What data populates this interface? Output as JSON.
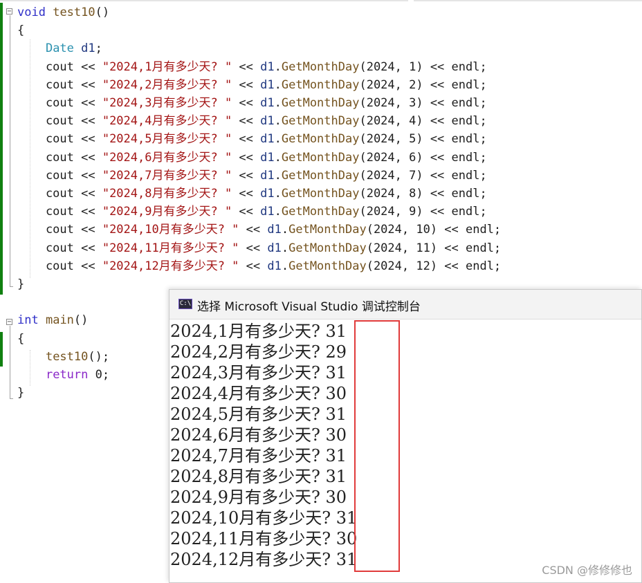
{
  "editor": {
    "lines": [
      {
        "fold": "minus",
        "parts": [
          [
            "kw",
            "void"
          ],
          [
            "op",
            " "
          ],
          [
            "fn",
            "test10"
          ],
          [
            "op",
            "()"
          ]
        ]
      },
      {
        "parts": [
          [
            "op",
            "{"
          ]
        ]
      },
      {
        "parts": [
          [
            "op",
            "    "
          ],
          [
            "ty",
            "Date"
          ],
          [
            "op",
            " "
          ],
          [
            "id",
            "d1"
          ],
          [
            "op",
            ";"
          ]
        ]
      },
      {
        "parts": [
          [
            "op",
            "    cout << "
          ],
          [
            "str",
            "\"2024,1月有多少天? \""
          ],
          [
            "op",
            " << "
          ],
          [
            "id",
            "d1"
          ],
          [
            "op",
            "."
          ],
          [
            "fn",
            "GetMonthDay"
          ],
          [
            "op",
            "(2024, 1) << endl;"
          ]
        ]
      },
      {
        "parts": [
          [
            "op",
            "    cout << "
          ],
          [
            "str",
            "\"2024,2月有多少天? \""
          ],
          [
            "op",
            " << "
          ],
          [
            "id",
            "d1"
          ],
          [
            "op",
            "."
          ],
          [
            "fn",
            "GetMonthDay"
          ],
          [
            "op",
            "(2024, 2) << endl;"
          ]
        ]
      },
      {
        "parts": [
          [
            "op",
            "    cout << "
          ],
          [
            "str",
            "\"2024,3月有多少天? \""
          ],
          [
            "op",
            " << "
          ],
          [
            "id",
            "d1"
          ],
          [
            "op",
            "."
          ],
          [
            "fn",
            "GetMonthDay"
          ],
          [
            "op",
            "(2024, 3) << endl;"
          ]
        ]
      },
      {
        "parts": [
          [
            "op",
            "    cout << "
          ],
          [
            "str",
            "\"2024,4月有多少天? \""
          ],
          [
            "op",
            " << "
          ],
          [
            "id",
            "d1"
          ],
          [
            "op",
            "."
          ],
          [
            "fn",
            "GetMonthDay"
          ],
          [
            "op",
            "(2024, 4) << endl;"
          ]
        ]
      },
      {
        "parts": [
          [
            "op",
            "    cout << "
          ],
          [
            "str",
            "\"2024,5月有多少天? \""
          ],
          [
            "op",
            " << "
          ],
          [
            "id",
            "d1"
          ],
          [
            "op",
            "."
          ],
          [
            "fn",
            "GetMonthDay"
          ],
          [
            "op",
            "(2024, 5) << endl;"
          ]
        ]
      },
      {
        "parts": [
          [
            "op",
            "    cout << "
          ],
          [
            "str",
            "\"2024,6月有多少天? \""
          ],
          [
            "op",
            " << "
          ],
          [
            "id",
            "d1"
          ],
          [
            "op",
            "."
          ],
          [
            "fn",
            "GetMonthDay"
          ],
          [
            "op",
            "(2024, 6) << endl;"
          ]
        ]
      },
      {
        "parts": [
          [
            "op",
            "    cout << "
          ],
          [
            "str",
            "\"2024,7月有多少天? \""
          ],
          [
            "op",
            " << "
          ],
          [
            "id",
            "d1"
          ],
          [
            "op",
            "."
          ],
          [
            "fn",
            "GetMonthDay"
          ],
          [
            "op",
            "(2024, 7) << endl;"
          ]
        ]
      },
      {
        "parts": [
          [
            "op",
            "    cout << "
          ],
          [
            "str",
            "\"2024,8月有多少天? \""
          ],
          [
            "op",
            " << "
          ],
          [
            "id",
            "d1"
          ],
          [
            "op",
            "."
          ],
          [
            "fn",
            "GetMonthDay"
          ],
          [
            "op",
            "(2024, 8) << endl;"
          ]
        ]
      },
      {
        "parts": [
          [
            "op",
            "    cout << "
          ],
          [
            "str",
            "\"2024,9月有多少天? \""
          ],
          [
            "op",
            " << "
          ],
          [
            "id",
            "d1"
          ],
          [
            "op",
            "."
          ],
          [
            "fn",
            "GetMonthDay"
          ],
          [
            "op",
            "(2024, 9) << endl;"
          ]
        ]
      },
      {
        "parts": [
          [
            "op",
            "    cout << "
          ],
          [
            "str",
            "\"2024,10月有多少天? \""
          ],
          [
            "op",
            " << "
          ],
          [
            "id",
            "d1"
          ],
          [
            "op",
            "."
          ],
          [
            "fn",
            "GetMonthDay"
          ],
          [
            "op",
            "(2024, 10) << endl;"
          ]
        ]
      },
      {
        "parts": [
          [
            "op",
            "    cout << "
          ],
          [
            "str",
            "\"2024,11月有多少天? \""
          ],
          [
            "op",
            " << "
          ],
          [
            "id",
            "d1"
          ],
          [
            "op",
            "."
          ],
          [
            "fn",
            "GetMonthDay"
          ],
          [
            "op",
            "(2024, 11) << endl;"
          ]
        ]
      },
      {
        "parts": [
          [
            "op",
            "    cout << "
          ],
          [
            "str",
            "\"2024,12月有多少天? \""
          ],
          [
            "op",
            " << "
          ],
          [
            "id",
            "d1"
          ],
          [
            "op",
            "."
          ],
          [
            "fn",
            "GetMonthDay"
          ],
          [
            "op",
            "(2024, 12) << endl;"
          ]
        ]
      },
      {
        "parts": [
          [
            "op",
            "}"
          ]
        ]
      },
      {
        "parts": []
      },
      {
        "fold": "minus",
        "parts": [
          [
            "kw",
            "int"
          ],
          [
            "op",
            " "
          ],
          [
            "fn",
            "main"
          ],
          [
            "op",
            "()"
          ]
        ]
      },
      {
        "parts": [
          [
            "op",
            "{"
          ]
        ]
      },
      {
        "parts": [
          [
            "op",
            "    "
          ],
          [
            "fn",
            "test10"
          ],
          [
            "op",
            "();"
          ]
        ]
      },
      {
        "parts": [
          [
            "op",
            "    "
          ],
          [
            "kw2",
            "return"
          ],
          [
            "op",
            " 0;"
          ]
        ]
      },
      {
        "parts": [
          [
            "op",
            "}"
          ]
        ]
      }
    ]
  },
  "console": {
    "icon_text": "C:\\",
    "title": "选择 Microsoft Visual Studio 调试控制台",
    "output": [
      {
        "prompt": "2024,1月有多少天? ",
        "value": "31"
      },
      {
        "prompt": "2024,2月有多少天? ",
        "value": "29"
      },
      {
        "prompt": "2024,3月有多少天? ",
        "value": "31"
      },
      {
        "prompt": "2024,4月有多少天? ",
        "value": "30"
      },
      {
        "prompt": "2024,5月有多少天? ",
        "value": "31"
      },
      {
        "prompt": "2024,6月有多少天? ",
        "value": "30"
      },
      {
        "prompt": "2024,7月有多少天? ",
        "value": "31"
      },
      {
        "prompt": "2024,8月有多少天? ",
        "value": "31"
      },
      {
        "prompt": "2024,9月有多少天? ",
        "value": "30"
      },
      {
        "prompt": "2024,10月有多少天? ",
        "value": "31"
      },
      {
        "prompt": "2024,11月有多少天? ",
        "value": "30"
      },
      {
        "prompt": "2024,12月有多少天? ",
        "value": "31"
      }
    ]
  },
  "watermark": "CSDN @修修修也",
  "colors": {
    "keyword": "#3030c8",
    "type": "#2b91af",
    "string": "#a31515",
    "function": "#74531f",
    "highlight_box": "#e03a3a",
    "change_bar": "#108010"
  }
}
